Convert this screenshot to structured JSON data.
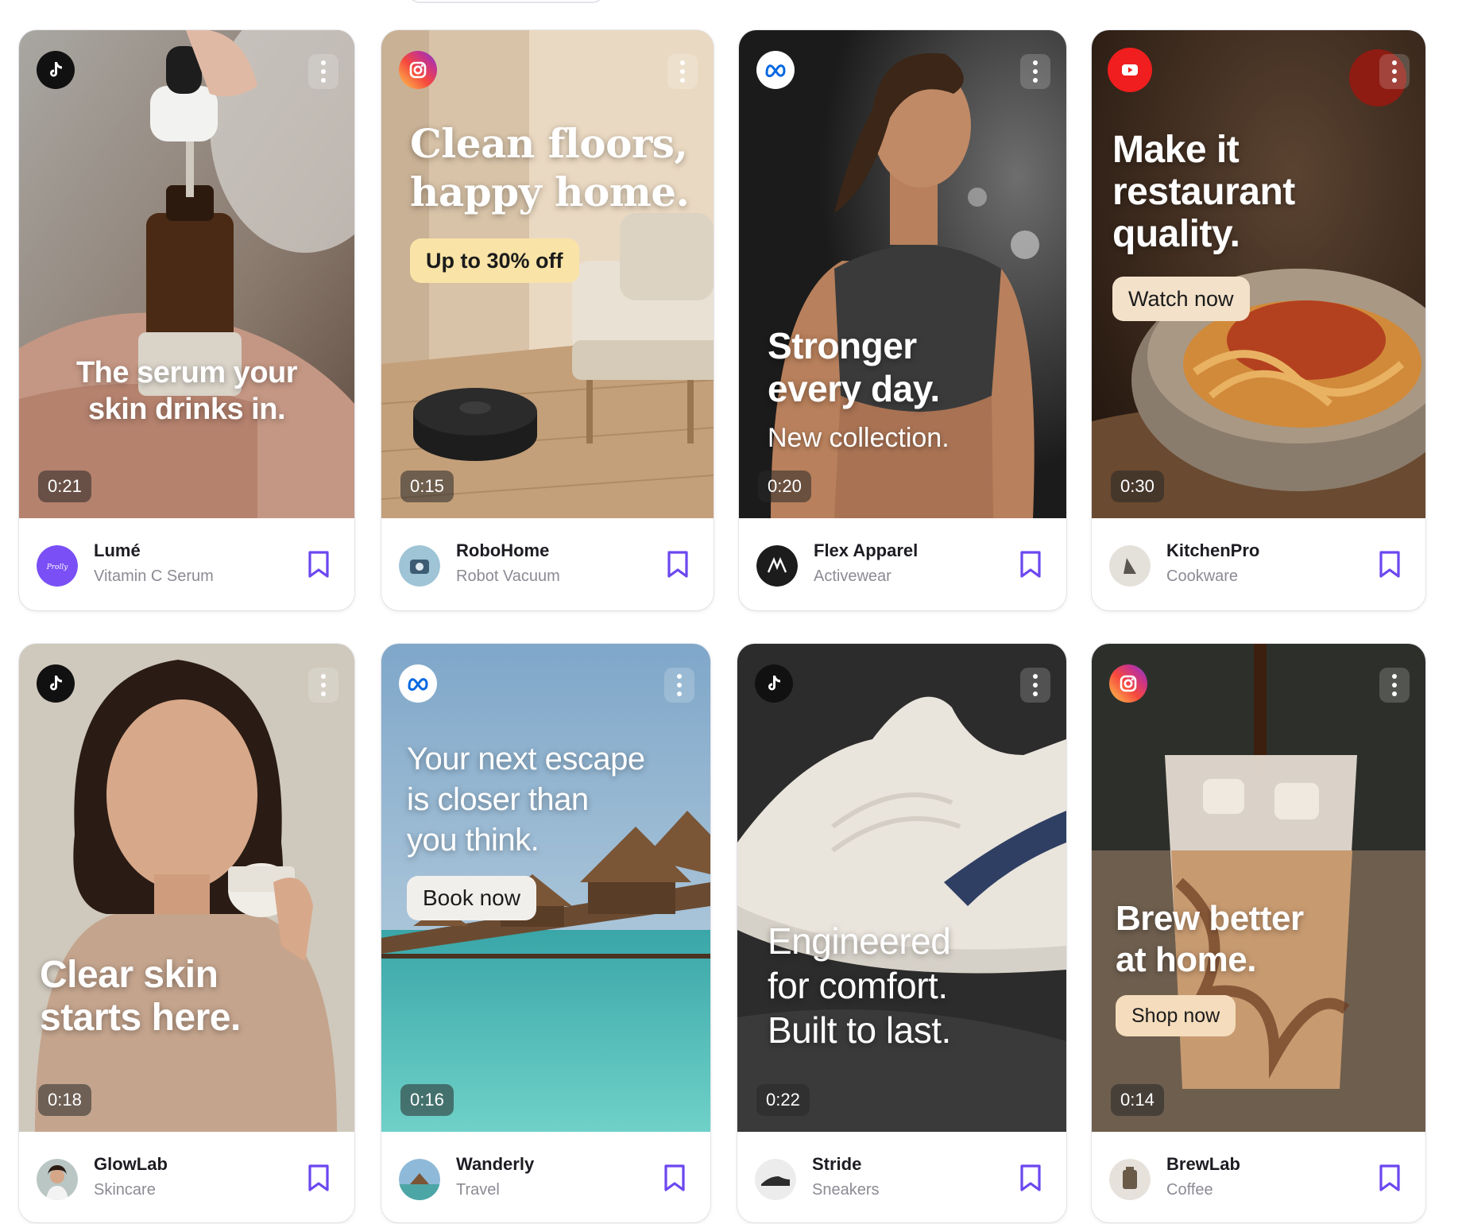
{
  "colors": {
    "accent": "#6b47f0",
    "tiktok": "#111111",
    "meta": "#0668e1",
    "youtube": "#ff0000"
  },
  "cards": [
    {
      "platform": "tiktok-icon",
      "headline": "The serum your\nskin drinks in.",
      "cta": "",
      "subline": "",
      "duration": "0:21",
      "brand": "Lumé",
      "product": "Vitamin C Serum"
    },
    {
      "platform": "instagram-icon",
      "headline": "Clean floors,\nhappy home.",
      "cta": "Up to 30% off",
      "subline": "",
      "duration": "0:15",
      "brand": "RoboHome",
      "product": "Robot Vacuum"
    },
    {
      "platform": "meta-icon",
      "headline": "Stronger\nevery day.",
      "cta": "",
      "subline": "New collection.",
      "duration": "0:20",
      "brand": "Flex Apparel",
      "product": "Activewear"
    },
    {
      "platform": "youtube-icon",
      "headline": "Make it\nrestaurant\nquality.",
      "cta": "Watch now",
      "subline": "",
      "duration": "0:30",
      "brand": "KitchenPro",
      "product": "Cookware"
    },
    {
      "platform": "tiktok-icon",
      "headline": "Clear skin\nstarts here.",
      "cta": "",
      "subline": "",
      "duration": "0:18",
      "brand": "GlowLab",
      "product": "Skincare"
    },
    {
      "platform": "meta-icon",
      "headline": "Your next escape\nis closer than\nyou think.",
      "cta": "Book now",
      "subline": "",
      "duration": "0:16",
      "brand": "Wanderly",
      "product": "Travel"
    },
    {
      "platform": "tiktok-icon",
      "headline": "Engineered\nfor comfort.\nBuilt to last.",
      "cta": "",
      "subline": "",
      "duration": "0:22",
      "brand": "Stride",
      "product": "Sneakers"
    },
    {
      "platform": "instagram-icon",
      "headline": "Brew better\nat home.",
      "cta": "Shop now",
      "subline": "",
      "duration": "0:14",
      "brand": "BrewLab",
      "product": "Coffee"
    }
  ]
}
